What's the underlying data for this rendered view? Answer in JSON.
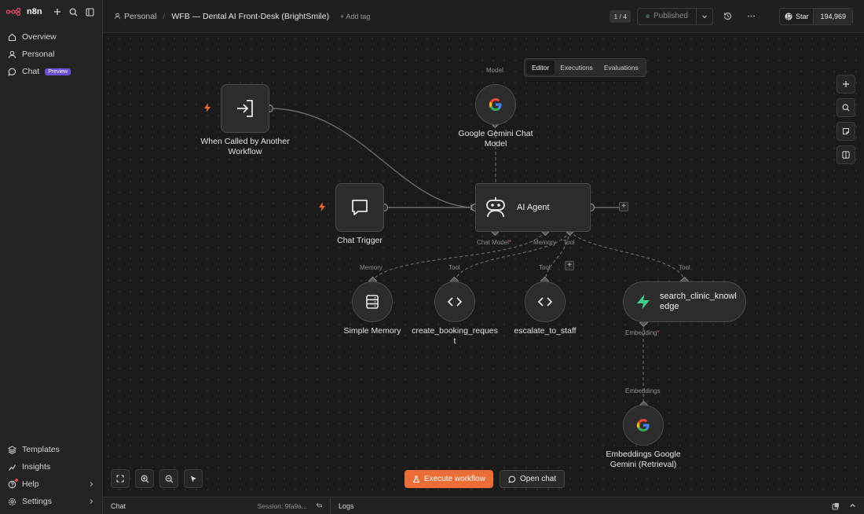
{
  "app": {
    "name": "n8n"
  },
  "sidebar": {
    "items": [
      {
        "label": "Overview",
        "icon": "home-icon"
      },
      {
        "label": "Personal",
        "icon": "user-icon"
      },
      {
        "label": "Chat",
        "icon": "chat-icon",
        "badge": "Preview"
      }
    ],
    "bottom_items": [
      {
        "label": "Templates",
        "icon": "templates-icon"
      },
      {
        "label": "Insights",
        "icon": "insights-icon"
      },
      {
        "label": "Help",
        "icon": "help-icon"
      },
      {
        "label": "Settings",
        "icon": "gear-icon"
      }
    ]
  },
  "header": {
    "breadcrumb_project": "Personal",
    "workflow_title": "WFB — Dental AI Front-Desk (BrightSmile)",
    "add_tag": "+ Add tag",
    "pager": "1 / 4",
    "publish_label": "Published",
    "github_star": "Star",
    "github_count": "194,969"
  },
  "tabs": [
    {
      "label": "Editor",
      "active": true
    },
    {
      "label": "Executions",
      "active": false
    },
    {
      "label": "Evaluations",
      "active": false
    }
  ],
  "nodes": {
    "trigger_called": "When Called by Another Workflow",
    "chat_trigger": "Chat Trigger",
    "gemini_model": "Google Gemini Chat Model",
    "ai_agent": "AI Agent",
    "simple_memory": "Simple Memory",
    "create_booking": "create_booking_request",
    "escalate": "escalate_to_staff",
    "search_clinic": "search_clinic_knowledge",
    "embeddings": "Embeddings Google Gemini (Retrieval)"
  },
  "ports": {
    "model": "Model",
    "chat_model": "Chat Model",
    "memory": "Memory",
    "tool": "Tool",
    "embedding": "Embedding",
    "embeddings": "Embeddings",
    "required_mark": "*"
  },
  "controls": {
    "execute": "Execute workflow",
    "open_chat": "Open chat"
  },
  "bottom_bar": {
    "chat": "Chat",
    "session": "Session: 9fa9a...",
    "logs": "Logs"
  },
  "colors": {
    "accent": "#ec6d36",
    "canvas": "#1a1a1a",
    "node": "#2c2c2c",
    "preview_badge": "#6b4fd8",
    "required": "#e2574c"
  }
}
